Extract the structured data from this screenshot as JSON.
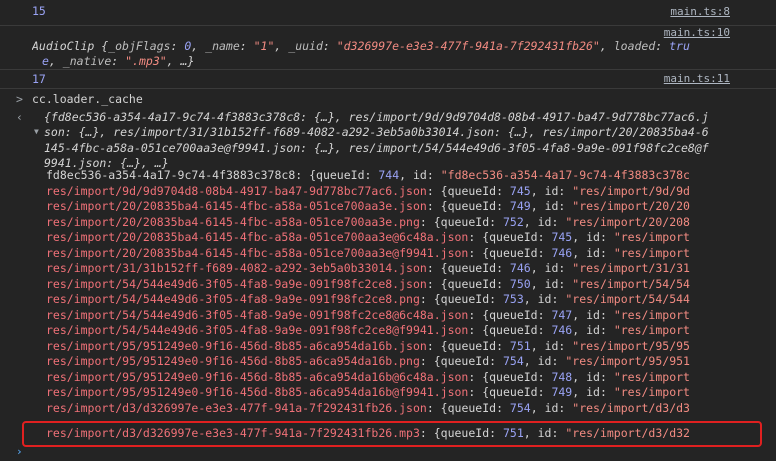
{
  "log": [
    {
      "value": "15",
      "source": "main.ts:8"
    },
    {
      "prefix": "AudioClip",
      "body_parts": [
        {
          "t": " {",
          "c": ""
        },
        {
          "t": "_objFlags",
          "c": "key"
        },
        {
          "t": ": ",
          "c": ""
        },
        {
          "t": "0",
          "c": "num"
        },
        {
          "t": ", ",
          "c": ""
        },
        {
          "t": "_name",
          "c": "key"
        },
        {
          "t": ": ",
          "c": ""
        },
        {
          "t": "\"1\"",
          "c": "str"
        },
        {
          "t": ", ",
          "c": ""
        },
        {
          "t": "_uuid",
          "c": "key"
        },
        {
          "t": ": ",
          "c": ""
        },
        {
          "t": "\"d326997e-e3e3-477f-941a-7f292431fb26\"",
          "c": "str"
        },
        {
          "t": ", ",
          "c": ""
        },
        {
          "t": "loaded",
          "c": "key"
        },
        {
          "t": ": ",
          "c": ""
        },
        {
          "t": "tru",
          "c": "num"
        }
      ],
      "line2_parts": [
        {
          "t": "e",
          "c": "num"
        },
        {
          "t": ", ",
          "c": ""
        },
        {
          "t": "_native",
          "c": "key"
        },
        {
          "t": ": ",
          "c": ""
        },
        {
          "t": "\".mp3\"",
          "c": "str"
        },
        {
          "t": ", …}",
          "c": ""
        }
      ],
      "source": "main.ts:10"
    },
    {
      "value": "17",
      "source": "main.ts:11"
    }
  ],
  "command": "cc.loader._cache",
  "summary_lines": [
    "{fd8ec536-a354-4a17-9c74-4f3883c378c8: {…}, res/import/9d/9d9704d8-08b4-4917-ba47-9d778bc77ac6.j",
    "son: {…}, res/import/31/31b152ff-f689-4082-a292-3eb5a0b33014.json: {…}, res/import/20/20835ba4-6",
    "145-4fbc-a58a-051ce700aa3e@f9941.json: {…}, res/import/54/544e49d6-3f05-4fa8-9a9e-091f98fc2ce8@f",
    "9941.json: {…}, …}"
  ],
  "entries": [
    {
      "key": "fd8ec536-a354-4a17-9c74-4f3883c378c8",
      "qid": "744",
      "id": "\"fd8ec536-a354-4a17-9c74-4f3883c378c"
    },
    {
      "key": "res/import/9d/9d9704d8-08b4-4917-ba47-9d778bc77ac6.json",
      "qid": "745",
      "id": "\"res/import/9d/9d"
    },
    {
      "key": "res/import/20/20835ba4-6145-4fbc-a58a-051ce700aa3e.json",
      "qid": "749",
      "id": "\"res/import/20/20"
    },
    {
      "key": "res/import/20/20835ba4-6145-4fbc-a58a-051ce700aa3e.png",
      "qid": "752",
      "id": "\"res/import/20/208"
    },
    {
      "key": "res/import/20/20835ba4-6145-4fbc-a58a-051ce700aa3e@6c48a.json",
      "qid": "745",
      "id": "\"res/import"
    },
    {
      "key": "res/import/20/20835ba4-6145-4fbc-a58a-051ce700aa3e@f9941.json",
      "qid": "746",
      "id": "\"res/import"
    },
    {
      "key": "res/import/31/31b152ff-f689-4082-a292-3eb5a0b33014.json",
      "qid": "746",
      "id": "\"res/import/31/31"
    },
    {
      "key": "res/import/54/544e49d6-3f05-4fa8-9a9e-091f98fc2ce8.json",
      "qid": "750",
      "id": "\"res/import/54/54"
    },
    {
      "key": "res/import/54/544e49d6-3f05-4fa8-9a9e-091f98fc2ce8.png",
      "qid": "753",
      "id": "\"res/import/54/544"
    },
    {
      "key": "res/import/54/544e49d6-3f05-4fa8-9a9e-091f98fc2ce8@6c48a.json",
      "qid": "747",
      "id": "\"res/import"
    },
    {
      "key": "res/import/54/544e49d6-3f05-4fa8-9a9e-091f98fc2ce8@f9941.json",
      "qid": "746",
      "id": "\"res/import"
    },
    {
      "key": "res/import/95/951249e0-9f16-456d-8b85-a6ca954da16b.json",
      "qid": "751",
      "id": "\"res/import/95/95"
    },
    {
      "key": "res/import/95/951249e0-9f16-456d-8b85-a6ca954da16b.png",
      "qid": "754",
      "id": "\"res/import/95/951"
    },
    {
      "key": "res/import/95/951249e0-9f16-456d-8b85-a6ca954da16b@6c48a.json",
      "qid": "748",
      "id": "\"res/import"
    },
    {
      "key": "res/import/95/951249e0-9f16-456d-8b85-a6ca954da16b@f9941.json",
      "qid": "749",
      "id": "\"res/import"
    },
    {
      "key": "res/import/d3/d326997e-e3e3-477f-941a-7f292431fb26.json",
      "qid": "754",
      "id": "\"res/import/d3/d3"
    },
    {
      "key": "res/import/d3/d326997e-e3e3-477f-941a-7f292431fb26.mp3",
      "qid": "751",
      "id": "\"res/import/d3/d32"
    }
  ],
  "labels": {
    "queue_key": "queueId",
    "id_key": "id"
  },
  "colors": {
    "highlight_border": "#e02020",
    "background": "#242424"
  }
}
